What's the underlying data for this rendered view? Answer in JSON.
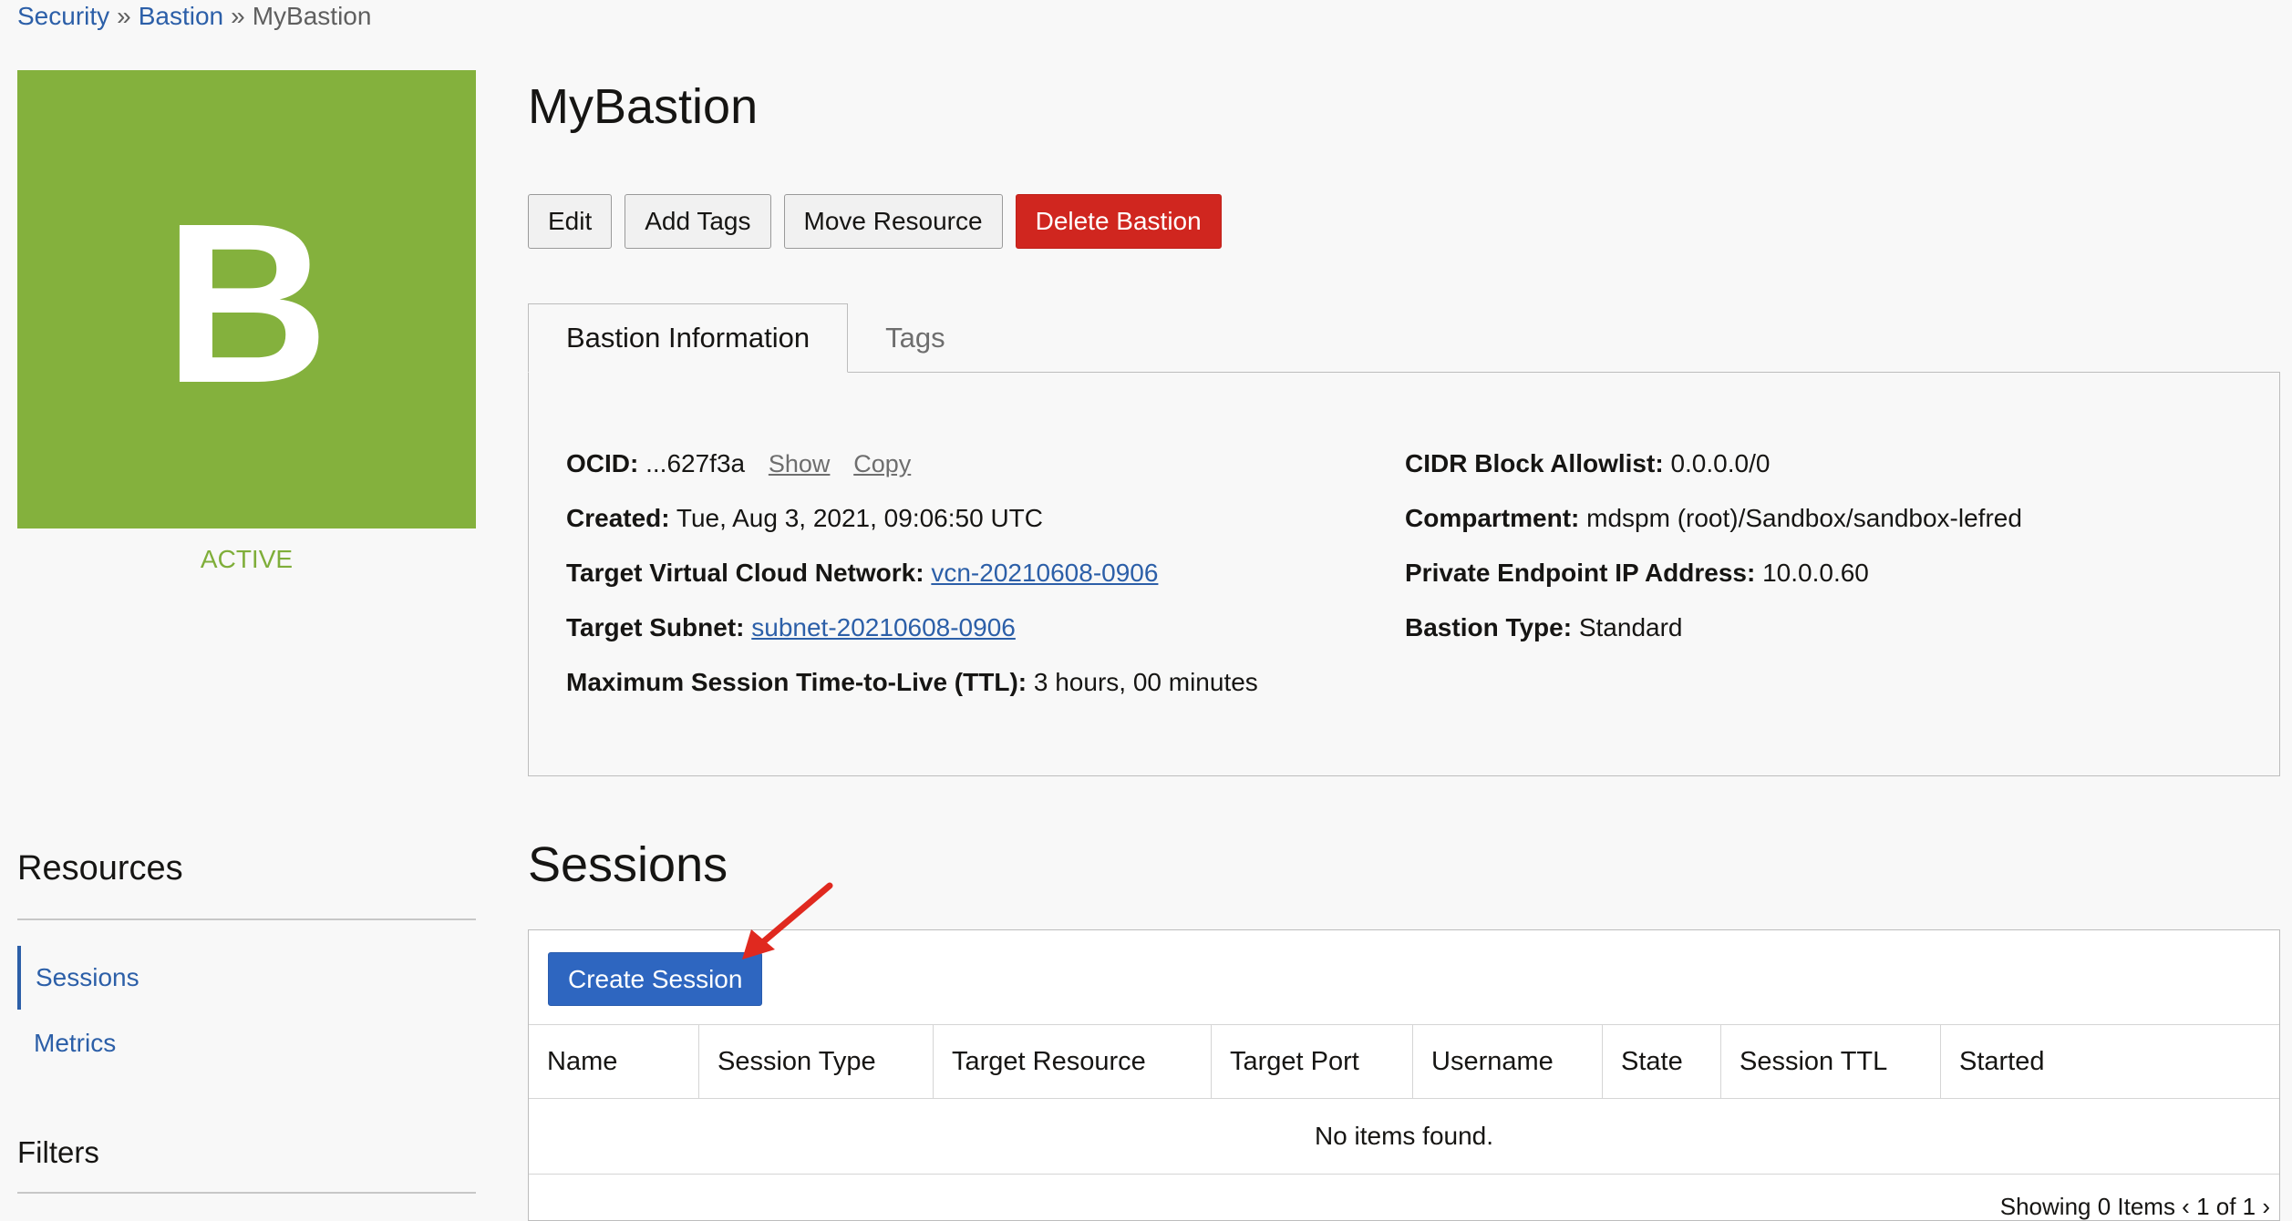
{
  "breadcrumb": {
    "items": [
      "Security",
      "Bastion"
    ],
    "current": "MyBastion",
    "separator": "»"
  },
  "resource": {
    "avatar_letter": "B",
    "state": "ACTIVE",
    "title": "MyBastion"
  },
  "actions": {
    "edit": "Edit",
    "add_tags": "Add Tags",
    "move": "Move Resource",
    "delete": "Delete Bastion"
  },
  "tabs": {
    "info": "Bastion Information",
    "tags": "Tags"
  },
  "info": {
    "ocid_label": "OCID:",
    "ocid_value": "...627f3a",
    "ocid_show": "Show",
    "ocid_copy": "Copy",
    "created_label": "Created:",
    "created_value": "Tue, Aug 3, 2021, 09:06:50 UTC",
    "vcn_label": "Target Virtual Cloud Network:",
    "vcn_value": "vcn-20210608-0906",
    "subnet_label": "Target Subnet:",
    "subnet_value": "subnet-20210608-0906",
    "ttl_label": "Maximum Session Time-to-Live (TTL):",
    "ttl_value": "3 hours, 00 minutes",
    "cidr_label": "CIDR Block Allowlist:",
    "cidr_value": "0.0.0.0/0",
    "compartment_label": "Compartment:",
    "compartment_value": "mdspm (root)/Sandbox/sandbox-lefred",
    "endpoint_label": "Private Endpoint IP Address:",
    "endpoint_value": "10.0.0.60",
    "type_label": "Bastion Type:",
    "type_value": "Standard"
  },
  "sidebar": {
    "resources_title": "Resources",
    "sessions": "Sessions",
    "metrics": "Metrics",
    "filters_title": "Filters"
  },
  "sessions": {
    "title": "Sessions",
    "create_button": "Create Session",
    "columns": [
      "Name",
      "Session Type",
      "Target Resource",
      "Target Port",
      "Username",
      "State",
      "Session TTL",
      "Started"
    ],
    "empty_text": "No items found.",
    "footer": "Showing 0 Items   ‹  1 of 1  ›"
  },
  "colors": {
    "accent": "#2e66c0",
    "danger": "#d0261f",
    "active_state": "#84b13d",
    "link": "#2c5fa8",
    "annotation_arrow": "#e0291f"
  },
  "icons": {
    "annotation": "red-arrow-icon"
  }
}
